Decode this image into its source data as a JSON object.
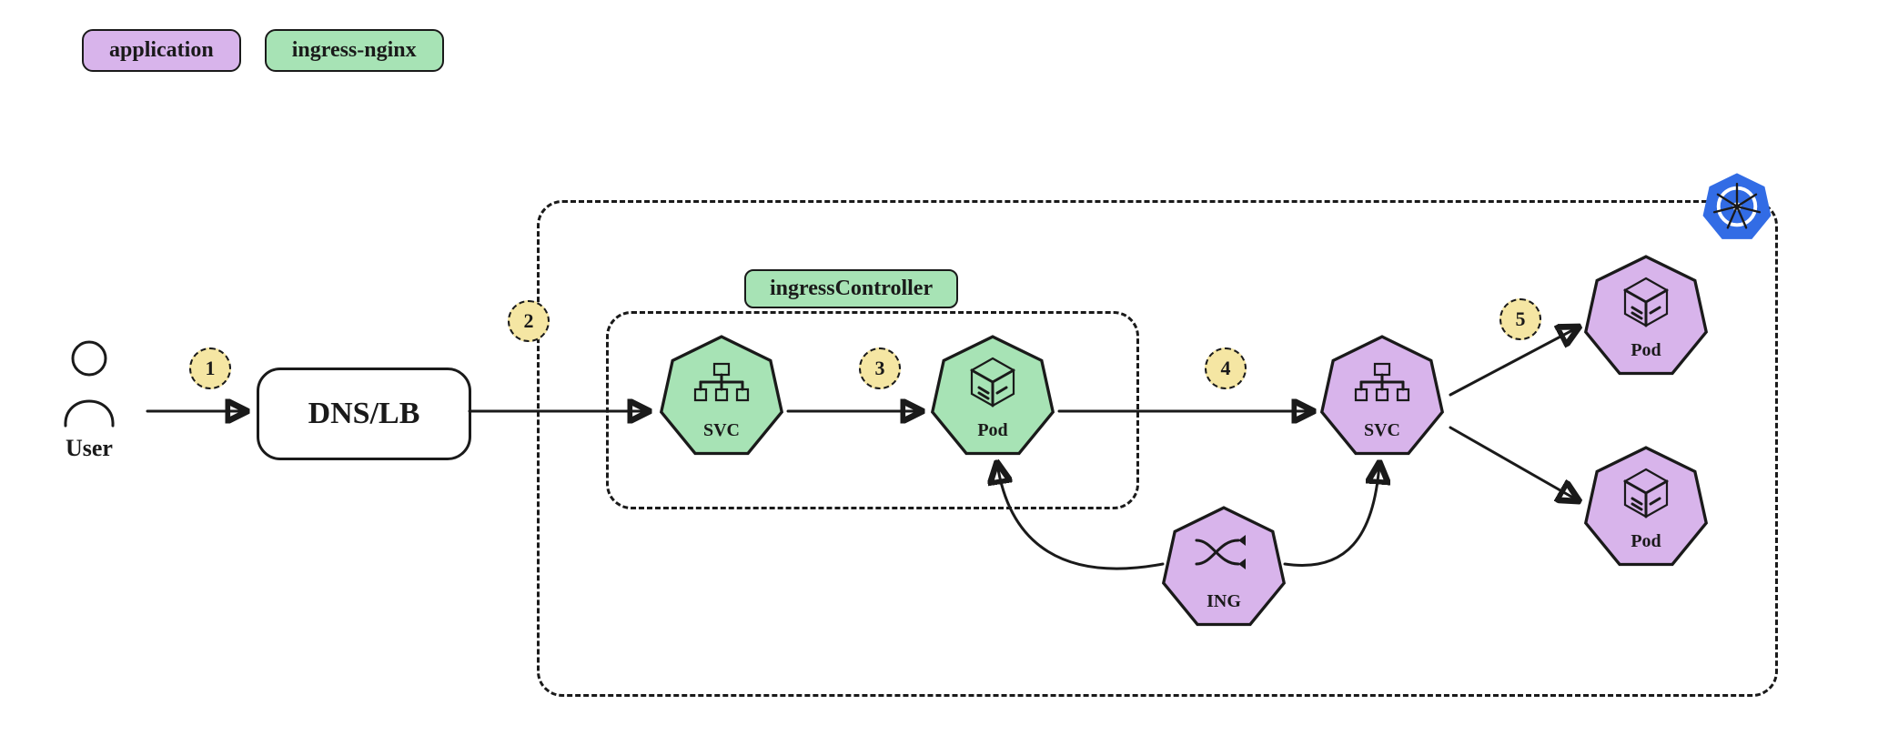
{
  "legend": {
    "application": "application",
    "ingress_nginx": "ingress-nginx"
  },
  "ingress_controller_label": "ingressController",
  "user_label": "User",
  "dnslb_label": "DNS/LB",
  "nodes": {
    "svc_green": "SVC",
    "pod_green": "Pod",
    "ing": "ING",
    "svc_purple": "SVC",
    "pod_purple_top": "Pod",
    "pod_purple_bot": "Pod"
  },
  "steps": {
    "s1": "1",
    "s2": "2",
    "s3": "3",
    "s4": "4",
    "s5": "5"
  }
}
